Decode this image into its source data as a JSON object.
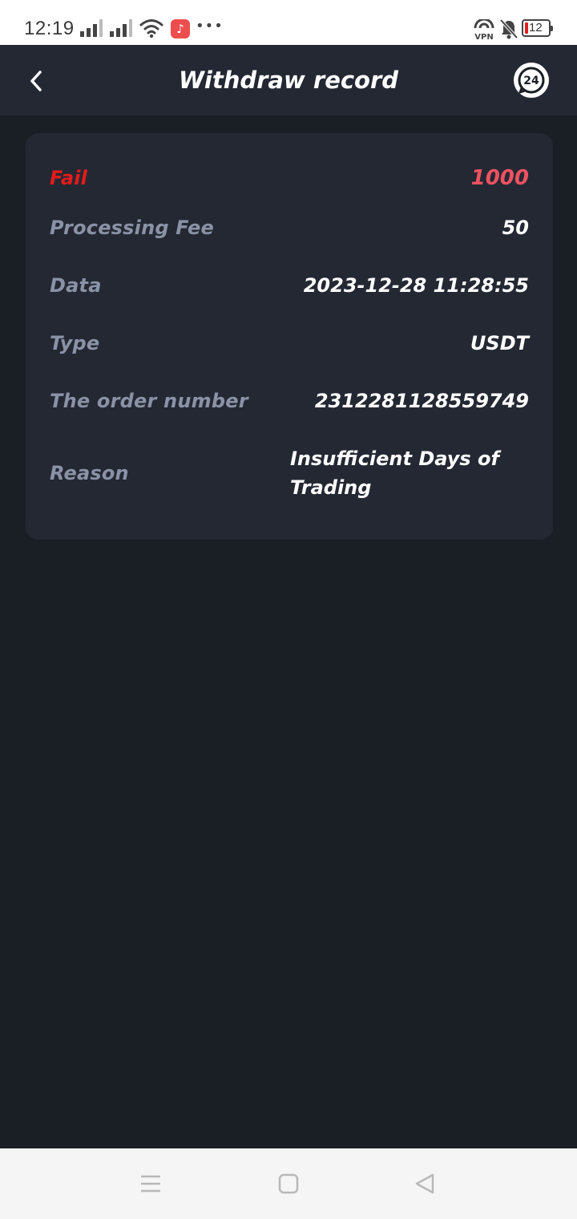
{
  "status_bar": {
    "time": "12:19",
    "battery": "12",
    "vpn_label": "VPN",
    "icons": [
      "signal-icon",
      "signal-icon",
      "wifi-icon",
      "music-app-icon",
      "more-dots-icon",
      "vpn-icon",
      "bell-muted-icon",
      "battery-icon"
    ]
  },
  "header": {
    "title": "Withdraw record",
    "support_label": "24",
    "back_icon": "chevron-left-icon"
  },
  "record": {
    "status_label": "Fail",
    "amount": "1000",
    "rows": [
      {
        "label": "Processing Fee",
        "value": "50"
      },
      {
        "label": "Data",
        "value": "2023-12-28 11:28:55"
      },
      {
        "label": "Type",
        "value": "USDT"
      },
      {
        "label": "The order number",
        "value": "2312281128559749"
      },
      {
        "label": "Reason",
        "value": "Insufficient Days of Trading"
      }
    ]
  },
  "nav_bar": {
    "icons": [
      "menu-icon",
      "home-icon",
      "back-triangle-icon"
    ]
  },
  "colors": {
    "background": "#1a1e25",
    "surface": "#232833",
    "fail": "#e31b1b",
    "amount": "#ef5261",
    "label": "#8a92a6",
    "value": "#ffffff"
  }
}
